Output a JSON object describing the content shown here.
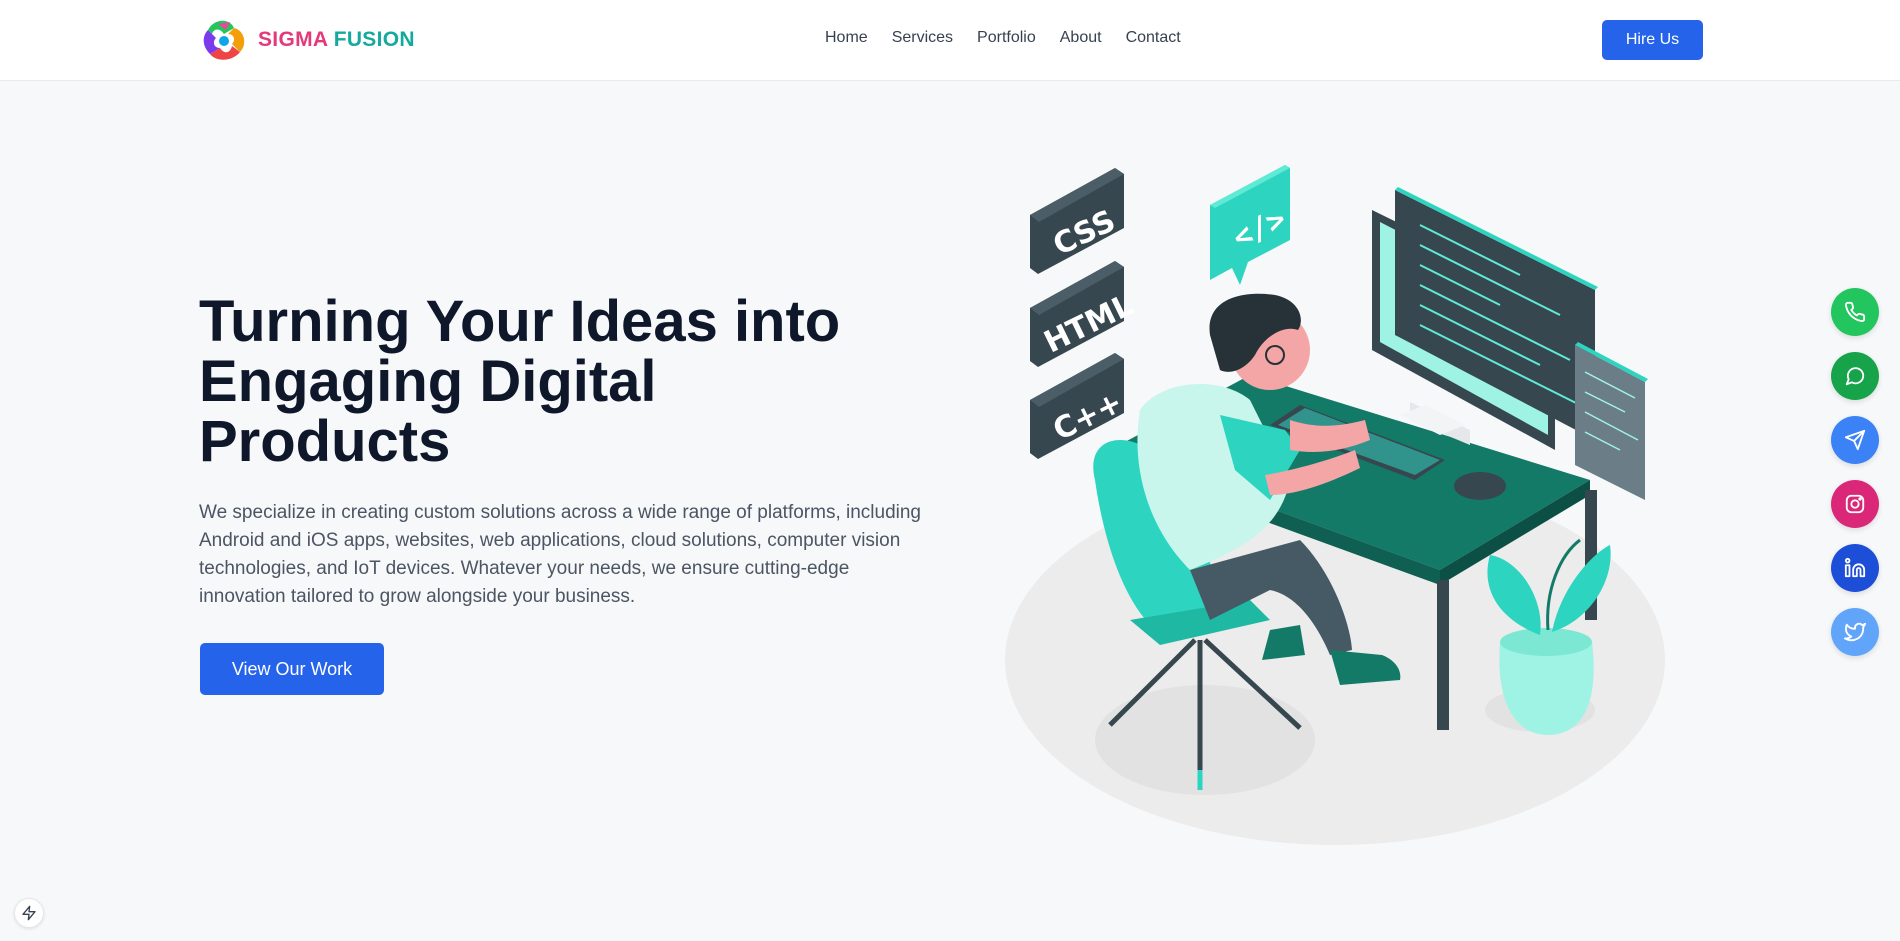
{
  "brand": {
    "name_part1": "SIGMA",
    "name_part2": " FUSION",
    "colors": {
      "sigma": "#e23a7a",
      "fusion": "#16a9a0"
    }
  },
  "nav": {
    "items": [
      {
        "label": "Home"
      },
      {
        "label": "Services"
      },
      {
        "label": "Portfolio"
      },
      {
        "label": "About"
      },
      {
        "label": "Contact"
      }
    ],
    "cta_label": "Hire Us"
  },
  "hero": {
    "title": "Turning Your Ideas into Engaging Digital Products",
    "description": "We specialize in creating custom solutions across a wide range of platforms, including Android and iOS apps, websites, web applications, cloud solutions, computer vision technologies, and IoT devices. Whatever your needs, we ensure cutting-edge innovation tailored to grow alongside your business.",
    "cta_label": "View Our Work"
  },
  "illustration": {
    "blocks": [
      "CSS",
      "HTML",
      "C++"
    ],
    "code_bubble": "</>"
  },
  "social": [
    {
      "icon": "phone-icon",
      "color": "#22c55e"
    },
    {
      "icon": "chat-icon",
      "color": "#16a34a"
    },
    {
      "icon": "send-icon",
      "color": "#3b82f6"
    },
    {
      "icon": "instagram-icon",
      "color": "#db2777"
    },
    {
      "icon": "linkedin-icon",
      "color": "#1d4ed8"
    },
    {
      "icon": "twitter-icon",
      "color": "#60a5fa"
    }
  ],
  "colors": {
    "accent": "#2563eb",
    "teal": "#2dd4bf",
    "dark_teal": "#147a68"
  }
}
